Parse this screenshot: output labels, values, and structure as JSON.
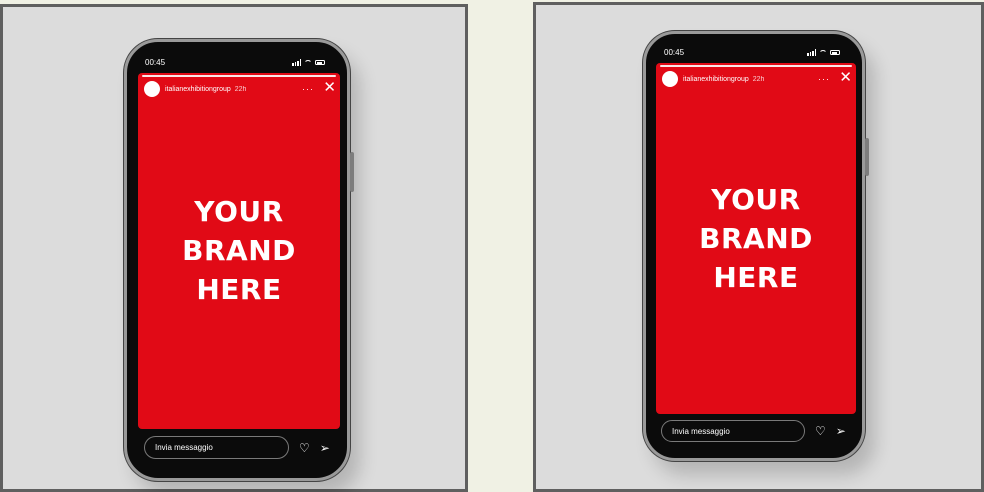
{
  "phones": [
    {
      "status": {
        "time": "00:45"
      },
      "story": {
        "username": "italianexhibitiongroup",
        "ago": "22h",
        "more": "···",
        "close": "✕"
      },
      "brand": {
        "line1": "YOUR",
        "line2": "BRAND",
        "line3": "HERE"
      },
      "reply": {
        "placeholder": "Invia messaggio",
        "like": "♡",
        "send": "➢"
      }
    },
    {
      "status": {
        "time": "00:45"
      },
      "story": {
        "username": "italianexhibitiongroup",
        "ago": "22h",
        "more": "···",
        "close": "✕"
      },
      "brand": {
        "line1": "YOUR",
        "line2": "BRAND",
        "line3": "HERE"
      },
      "reply": {
        "placeholder": "Invia messaggio",
        "like": "♡",
        "send": "➢"
      }
    }
  ],
  "colors": {
    "story_background": "#e10a16",
    "panel_background": "#dcdcdc",
    "page_background": "#f0f1e4"
  }
}
